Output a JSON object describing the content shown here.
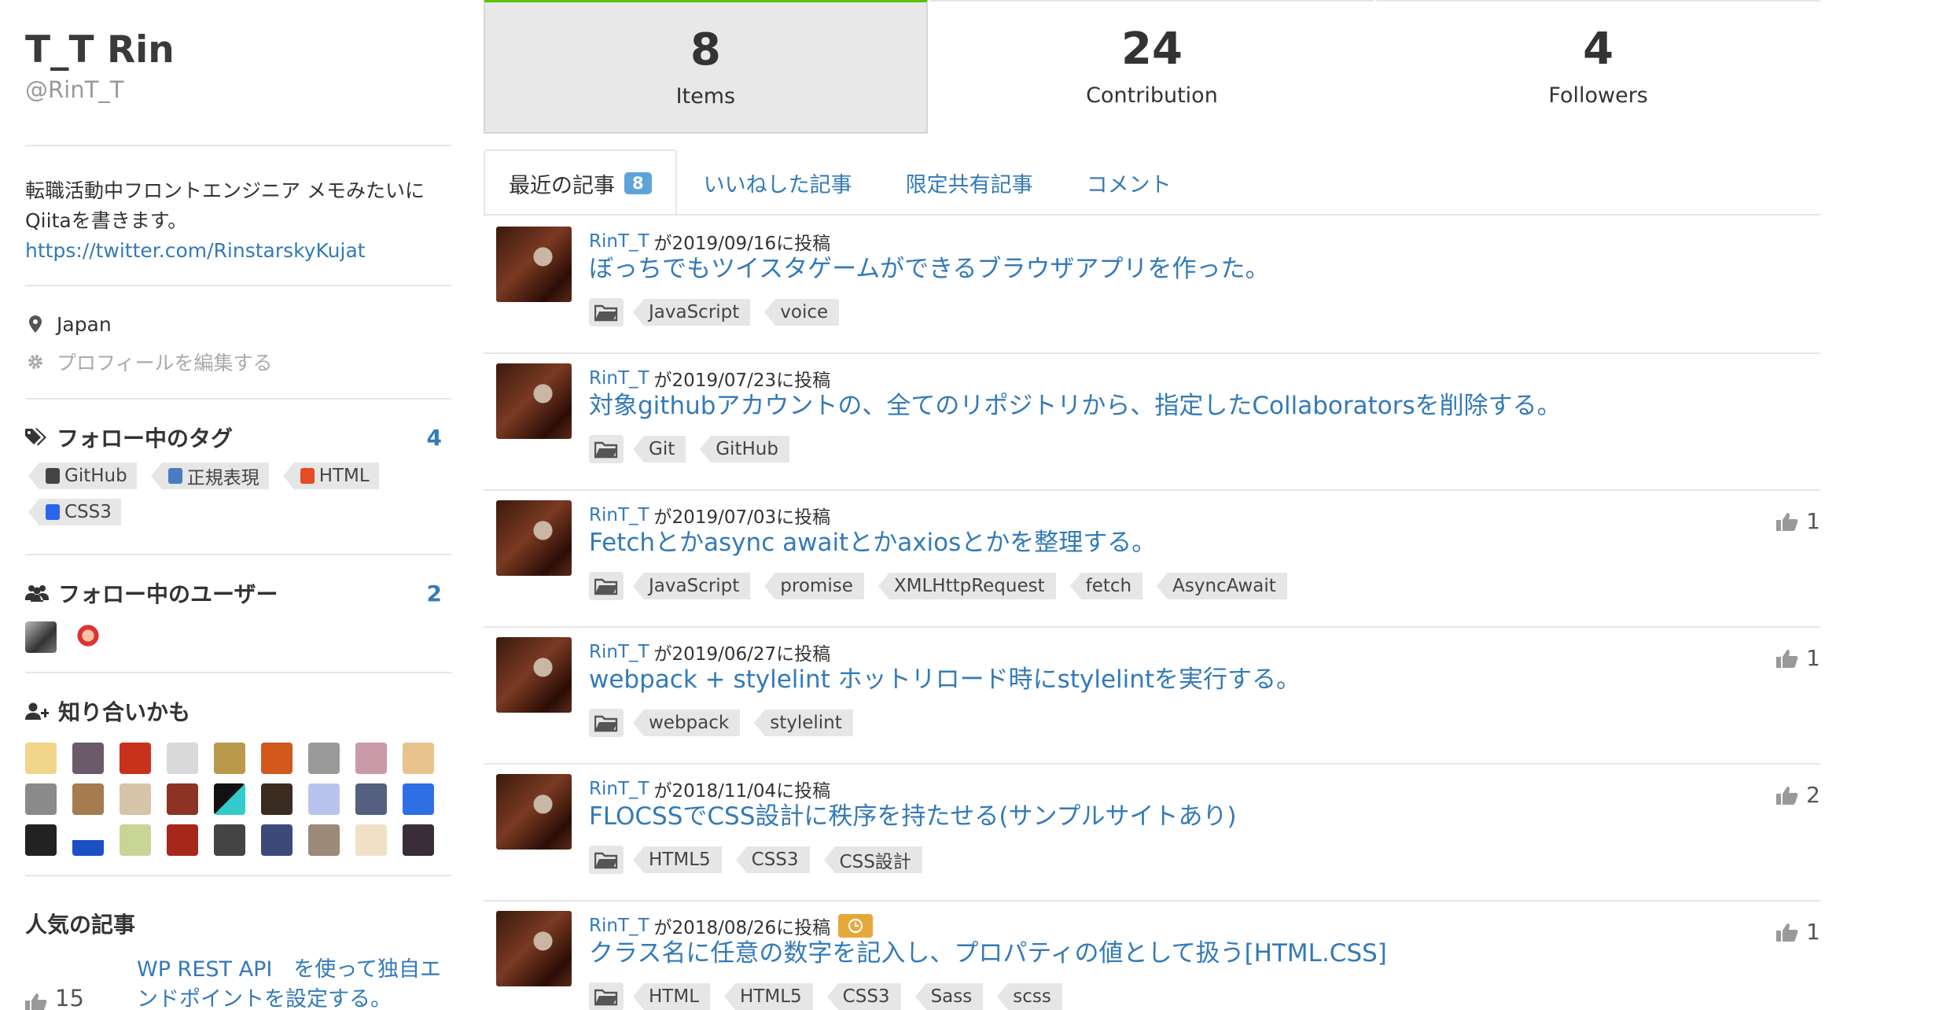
{
  "user": {
    "name": "T_T Rin",
    "handle": "@RinT_T",
    "bio_line1": "転職活動中フロントエンジニア メモみたいに",
    "bio_line2": "Qiitaを書きます。",
    "link": "https://twitter.com/RinstarskyKujat",
    "location": "Japan",
    "edit_profile": "プロフィールを編集する"
  },
  "followed_tags": {
    "title": "フォロー中のタグ",
    "count": "4",
    "tags": [
      "GitHub",
      "正規表現",
      "HTML",
      "CSS3"
    ]
  },
  "followed_users": {
    "title": "フォロー中のユーザー",
    "count": "2"
  },
  "suggestions": {
    "title": "知り合いかも"
  },
  "popular": {
    "title": "人気の記事",
    "likes": "15",
    "article": "WP REST API　を使って独自エンドポイントを設定する。"
  },
  "stats": [
    {
      "value": "8",
      "label": "Items"
    },
    {
      "value": "24",
      "label": "Contribution"
    },
    {
      "value": "4",
      "label": "Followers"
    }
  ],
  "tabs": {
    "recent": "最近の記事",
    "recent_count": "8",
    "liked": "いいねした記事",
    "limited": "限定共有記事",
    "comments": "コメント"
  },
  "items": [
    {
      "author": "RinT_T",
      "posted": "が2019/09/16に投稿",
      "title": "ぼっちでもツイスタゲームができるブラウザアプリを作った。",
      "tags": [
        "JavaScript",
        "voice"
      ],
      "likes": ""
    },
    {
      "author": "RinT_T",
      "posted": "が2019/07/23に投稿",
      "title": "対象githubアカウントの、全てのリポジトリから、指定したCollaboratorsを削除する。",
      "tags": [
        "Git",
        "GitHub"
      ],
      "likes": ""
    },
    {
      "author": "RinT_T",
      "posted": "が2019/07/03に投稿",
      "title": "Fetchとかasync awaitとかaxiosとかを整理する。",
      "tags": [
        "JavaScript",
        "promise",
        "XMLHttpRequest",
        "fetch",
        "AsyncAwait"
      ],
      "likes": "1"
    },
    {
      "author": "RinT_T",
      "posted": "が2019/06/27に投稿",
      "title": "webpack + stylelint ホットリロード時にstylelintを実行する。",
      "tags": [
        "webpack",
        "stylelint"
      ],
      "likes": "1"
    },
    {
      "author": "RinT_T",
      "posted": "が2018/11/04に投稿",
      "title": "FLOCSSでCSS設計に秩序を持たせる(サンプルサイトあり)",
      "tags": [
        "HTML5",
        "CSS3",
        "CSS設計"
      ],
      "likes": "2"
    },
    {
      "author": "RinT_T",
      "posted": "が2018/08/26に投稿",
      "title": "クラス名に任意の数字を記入し、プロパティの値として扱う[HTML.CSS]",
      "tags": [
        "HTML",
        "HTML5",
        "CSS3",
        "Sass",
        "scss"
      ],
      "likes": "1"
    }
  ],
  "colors": {
    "link": "#337ab7",
    "active_stat_border": "#55c500",
    "tab_badge": "#5ea4d9",
    "chip_bg": "#e6e6e6"
  }
}
